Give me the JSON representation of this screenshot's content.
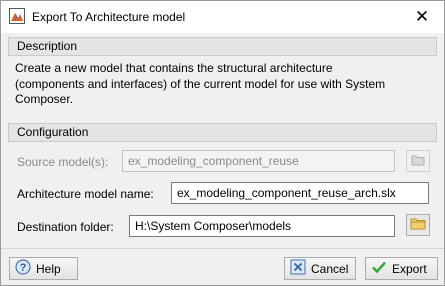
{
  "window": {
    "title": "Export To Architecture model",
    "close_glyph": "✕",
    "icon": "matlab-icon"
  },
  "description": {
    "header": "Description",
    "lines": [
      "Create a new model that contains the structural architecture",
      "(components and interfaces) of the current model for use with System",
      "Composer."
    ]
  },
  "configuration": {
    "header": "Configuration",
    "source_model": {
      "label": "Source model(s):",
      "value": "ex_modeling_component_reuse",
      "enabled": false,
      "browse_icon": "folder-icon"
    },
    "architecture_model_name": {
      "label": "Architecture model name:",
      "value": "ex_modeling_component_reuse_arch.slx"
    },
    "destination_folder": {
      "label": "Destination folder:",
      "value": "H:\\System Composer\\models",
      "browse_icon": "folder-icon"
    }
  },
  "buttons": {
    "help": {
      "label": "Help",
      "icon": "help-icon"
    },
    "cancel": {
      "label": "Cancel",
      "icon": "cancel-x-icon"
    },
    "export": {
      "label": "Export",
      "icon": "checkmark-icon"
    }
  },
  "colors": {
    "folder": "#e8c25a",
    "cancel_icon": "#3a6fb7",
    "export_check": "#3aa53a",
    "help_circle": "#2a5fa8"
  }
}
